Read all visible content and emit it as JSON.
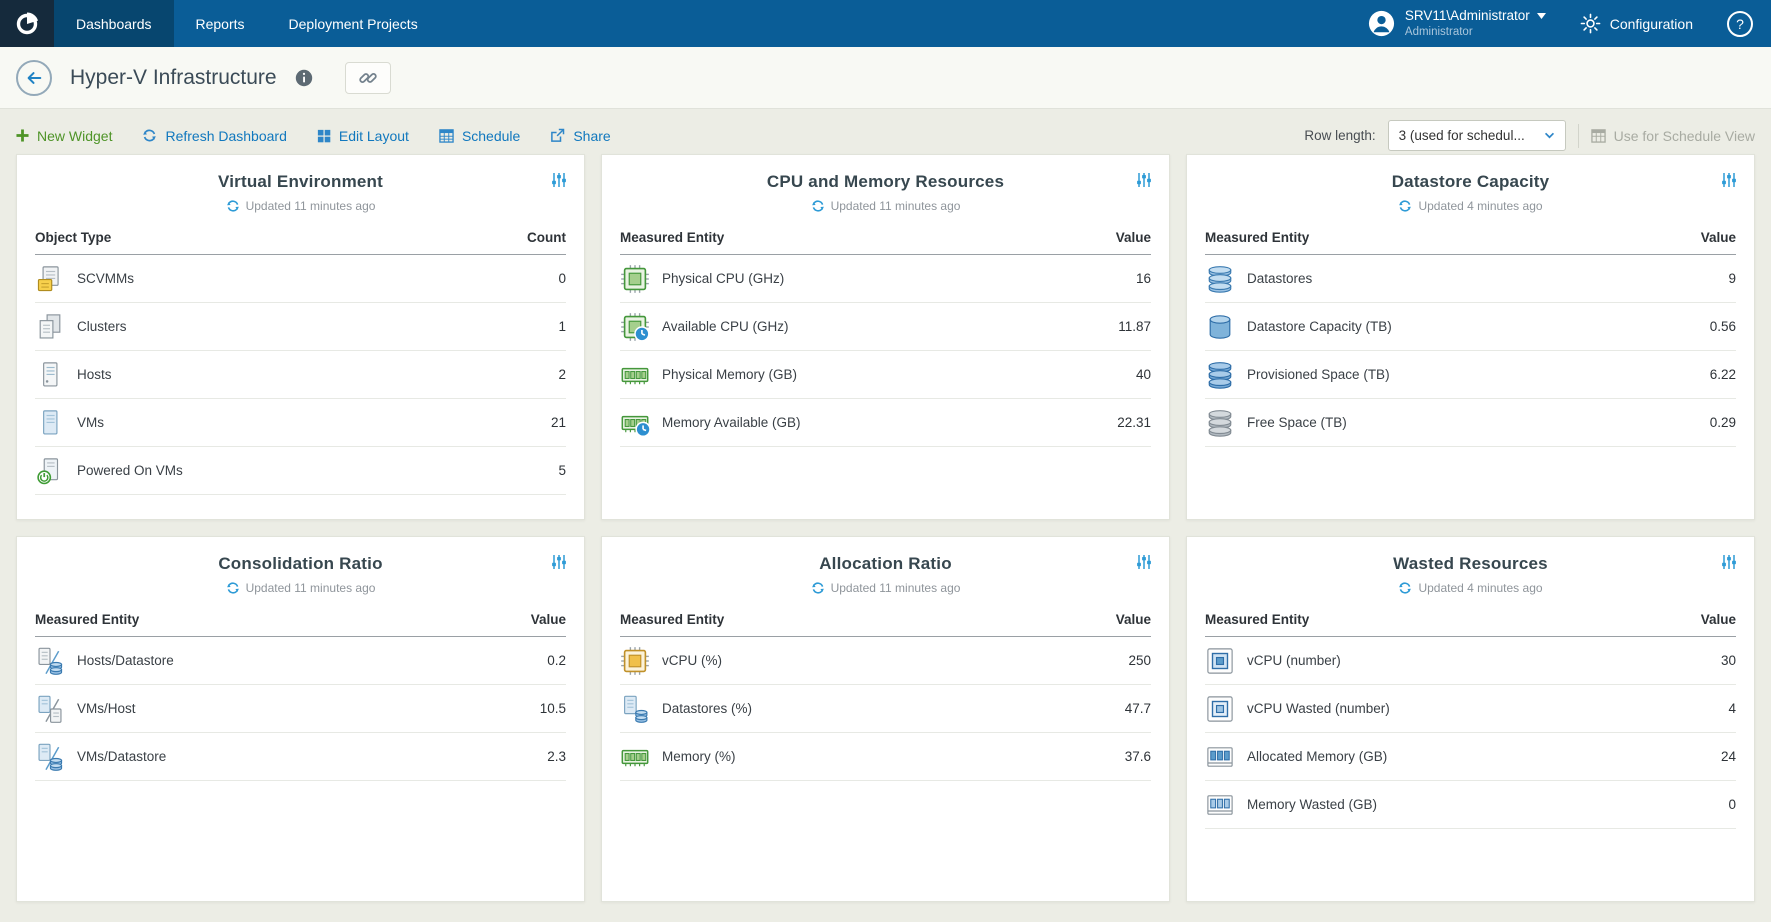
{
  "topnav": {
    "tabs": [
      {
        "label": "Dashboards"
      },
      {
        "label": "Reports"
      },
      {
        "label": "Deployment Projects"
      }
    ],
    "user_name": "SRV11\\Administrator",
    "user_role": "Administrator",
    "configuration": "Configuration",
    "help": "?"
  },
  "header": {
    "title": "Hyper-V Infrastructure"
  },
  "toolbar": {
    "new_widget": "New Widget",
    "refresh_dashboard": "Refresh Dashboard",
    "edit_layout": "Edit Layout",
    "schedule": "Schedule",
    "share": "Share",
    "row_length_label": "Row length:",
    "row_length_value": "3 (used for schedul...",
    "use_for_schedule_view": "Use for Schedule View"
  },
  "colors": {
    "topnav_blue": "#0a5d97",
    "active_tab_blue": "#07466f",
    "accent_blue": "#2e86c8",
    "accent_green": "#4e9427",
    "page_background": "#ecede5"
  },
  "widgets": [
    {
      "title": "Virtual Environment",
      "updated": "Updated 11 minutes ago",
      "columns": [
        "Object Type",
        "Count"
      ],
      "rows": [
        {
          "icon": "scvmm-icon",
          "label": "SCVMMs",
          "value": "0"
        },
        {
          "icon": "clusters-icon",
          "label": "Clusters",
          "value": "1"
        },
        {
          "icon": "hosts-icon",
          "label": "Hosts",
          "value": "2"
        },
        {
          "icon": "vms-icon",
          "label": "VMs",
          "value": "21"
        },
        {
          "icon": "powered-on-vms-icon",
          "label": "Powered On VMs",
          "value": "5"
        }
      ]
    },
    {
      "title": "CPU and Memory Resources",
      "updated": "Updated 11 minutes ago",
      "columns": [
        "Measured Entity",
        "Value"
      ],
      "rows": [
        {
          "icon": "physical-cpu-icon",
          "label": "Physical CPU (GHz)",
          "value": "16"
        },
        {
          "icon": "available-cpu-icon",
          "label": "Available CPU (GHz)",
          "value": "11.87"
        },
        {
          "icon": "physical-memory-icon",
          "label": "Physical Memory (GB)",
          "value": "40"
        },
        {
          "icon": "memory-available-icon",
          "label": "Memory Available (GB)",
          "value": "22.31"
        }
      ]
    },
    {
      "title": "Datastore Capacity",
      "updated": "Updated 4 minutes ago",
      "columns": [
        "Measured Entity",
        "Value"
      ],
      "rows": [
        {
          "icon": "datastores-icon",
          "label": "Datastores",
          "value": "9"
        },
        {
          "icon": "datastore-capacity-icon",
          "label": "Datastore Capacity (TB)",
          "value": "0.56"
        },
        {
          "icon": "provisioned-space-icon",
          "label": "Provisioned Space (TB)",
          "value": "6.22"
        },
        {
          "icon": "free-space-icon",
          "label": "Free Space (TB)",
          "value": "0.29"
        }
      ]
    },
    {
      "title": "Consolidation Ratio",
      "updated": "Updated 11 minutes ago",
      "columns": [
        "Measured Entity",
        "Value"
      ],
      "rows": [
        {
          "icon": "hosts-per-datastore-icon",
          "label": "Hosts/Datastore",
          "value": "0.2"
        },
        {
          "icon": "vms-per-host-icon",
          "label": "VMs/Host",
          "value": "10.5"
        },
        {
          "icon": "vms-per-datastore-icon",
          "label": "VMs/Datastore",
          "value": "2.3"
        }
      ]
    },
    {
      "title": "Allocation Ratio",
      "updated": "Updated 11 minutes ago",
      "columns": [
        "Measured Entity",
        "Value"
      ],
      "rows": [
        {
          "icon": "vcpu-percent-icon",
          "label": "vCPU (%)",
          "value": "250"
        },
        {
          "icon": "datastores-percent-icon",
          "label": "Datastores (%)",
          "value": "47.7"
        },
        {
          "icon": "memory-percent-icon",
          "label": "Memory (%)",
          "value": "37.6"
        }
      ]
    },
    {
      "title": "Wasted Resources",
      "updated": "Updated 4 minutes ago",
      "columns": [
        "Measured Entity",
        "Value"
      ],
      "rows": [
        {
          "icon": "vcpu-number-icon",
          "label": "vCPU (number)",
          "value": "30"
        },
        {
          "icon": "vcpu-wasted-icon",
          "label": "vCPU Wasted (number)",
          "value": "4"
        },
        {
          "icon": "allocated-memory-icon",
          "label": "Allocated Memory (GB)",
          "value": "24"
        },
        {
          "icon": "memory-wasted-icon",
          "label": "Memory Wasted (GB)",
          "value": "0"
        }
      ]
    }
  ]
}
